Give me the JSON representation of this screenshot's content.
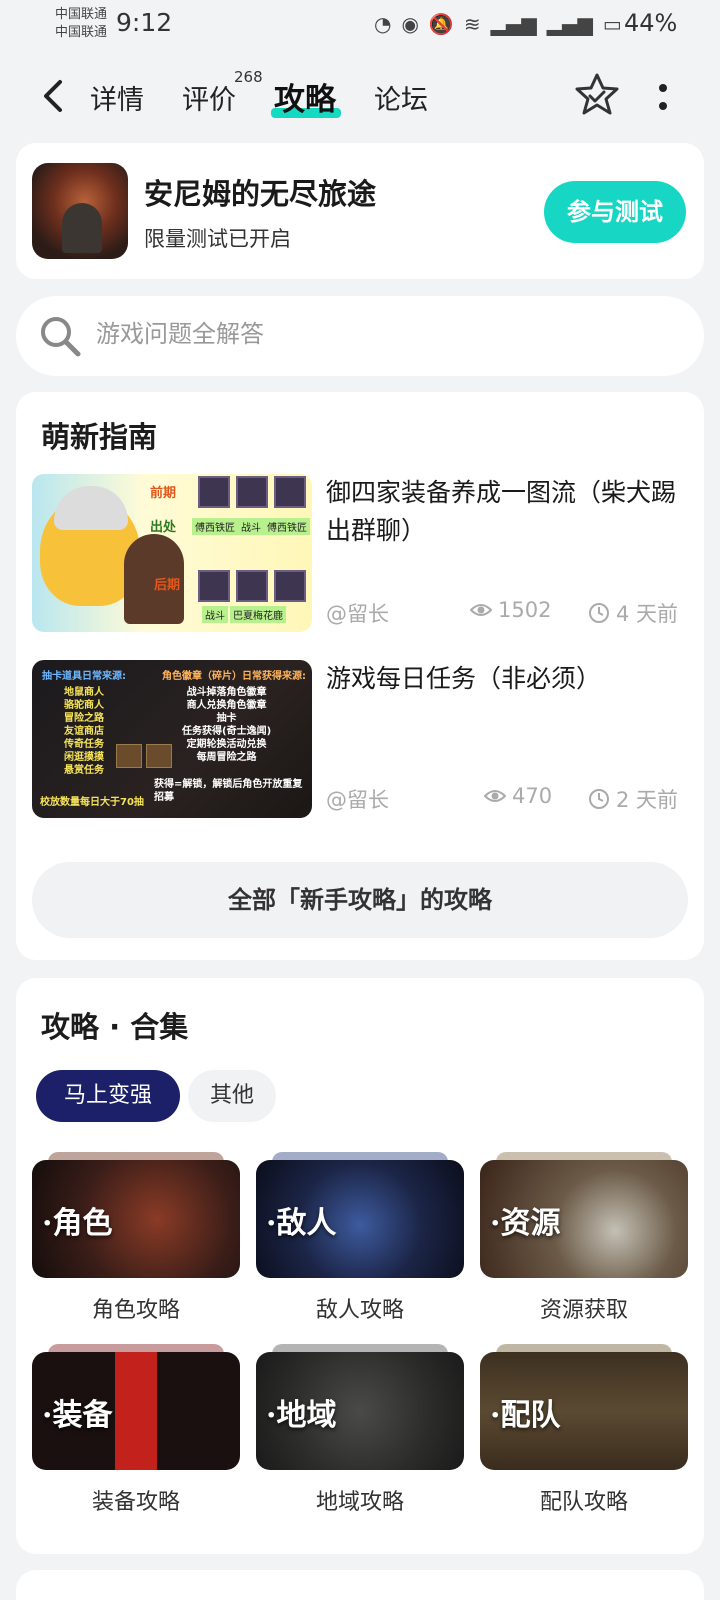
{
  "status_bar": {
    "carrier1": "中国联通",
    "carrier2": "中国联通",
    "time": "9:12",
    "battery": "44%"
  },
  "nav": {
    "tabs": [
      {
        "label": "详情"
      },
      {
        "label": "评价",
        "count": "268"
      },
      {
        "label": "攻略",
        "active": true
      },
      {
        "label": "论坛"
      }
    ]
  },
  "game": {
    "title": "安尼姆的无尽旅途",
    "subtitle": "限量测试已开启",
    "join_label": "参与测试"
  },
  "search": {
    "placeholder": "游戏问题全解答"
  },
  "newbie": {
    "title": "萌新指南",
    "items": [
      {
        "title": "御四家装备养成一图流（柴犬踢出群聊）",
        "author": "@留长",
        "views": "1502",
        "time": "4 天前",
        "thumb_text": {
          "early": "前期",
          "late": "后期",
          "source": "出处",
          "l1": "傅西铁匠",
          "l2": "战斗",
          "l3": "傅西铁匠",
          "l4": "战斗",
          "l5": "巴夏梅花鹿"
        }
      },
      {
        "title": "游戏每日任务（非必须）",
        "author": "@留长",
        "views": "470",
        "time": "2 天前",
        "thumb_text": {
          "left_head": "抽卡道具日常来源:",
          "left_lines": "地鼠商人\n骆驼商人\n冒险之路\n友谊商店\n传奇任务\n闲逛摸摸\n悬赏任务",
          "right_head": "角色徽章（碎片）日常获得来源:",
          "right_lines": "战斗掉落角色徽章\n商人兑换角色徽章\n抽卡\n任务获得(奇士逸闻)\n定期轮换活动兑换\n每周冒险之路",
          "note": "获得=解锁，解锁后角色开放重复招募",
          "footer": "校放数量每日大于70抽"
        }
      }
    ],
    "all_label": "全部「新手攻略」的攻略"
  },
  "collection": {
    "title": "攻略 · 合集",
    "chips": [
      "马上变强",
      "其他"
    ],
    "tiles": [
      {
        "word": "·角色",
        "label": "角色攻略"
      },
      {
        "word": "·敌人",
        "label": "敌人攻略"
      },
      {
        "word": "·资源",
        "label": "资源获取"
      },
      {
        "word": "·装备",
        "label": "装备攻略"
      },
      {
        "word": "·地域",
        "label": "地域攻略"
      },
      {
        "word": "·配队",
        "label": "配队攻略"
      }
    ]
  },
  "colors": {
    "accent": "#17d7c4",
    "chip_active": "#1b2068",
    "background": "#f2f3f5"
  }
}
